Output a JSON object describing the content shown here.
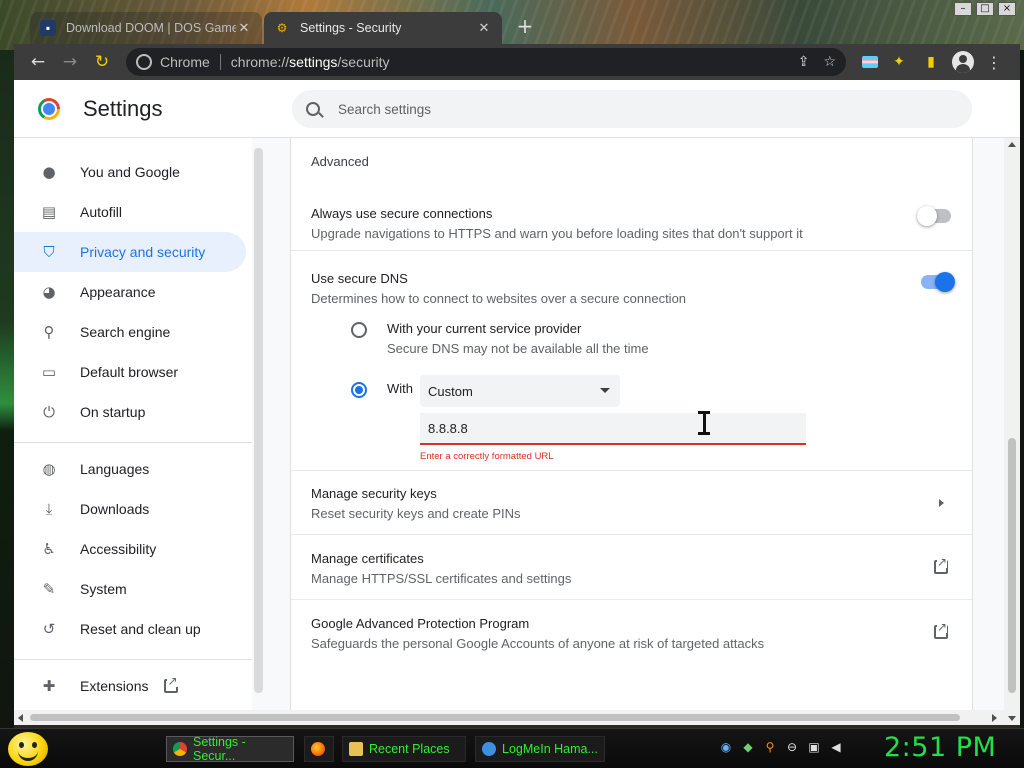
{
  "tabs": [
    {
      "title": "Download DOOM | DOS Games",
      "active": false
    },
    {
      "title": "Settings - Security",
      "active": true
    }
  ],
  "new_tab_label": "+",
  "omnibox": {
    "site_chip": "Chrome",
    "url_scheme": "chrome://",
    "url_host": "settings",
    "url_path": "/security"
  },
  "settings": {
    "title": "Settings",
    "search_placeholder": "Search settings",
    "sidebar": {
      "items": [
        {
          "label": "You and Google",
          "icon": "person-icon"
        },
        {
          "label": "Autofill",
          "icon": "clipboard-icon"
        },
        {
          "label": "Privacy and security",
          "icon": "shield-icon",
          "active": true
        },
        {
          "label": "Appearance",
          "icon": "palette-icon"
        },
        {
          "label": "Search engine",
          "icon": "search-icon"
        },
        {
          "label": "Default browser",
          "icon": "browser-icon"
        },
        {
          "label": "On startup",
          "icon": "power-icon"
        },
        {
          "label": "Languages",
          "icon": "globe-icon"
        },
        {
          "label": "Downloads",
          "icon": "download-icon"
        },
        {
          "label": "Accessibility",
          "icon": "accessibility-icon"
        },
        {
          "label": "System",
          "icon": "wrench-icon"
        },
        {
          "label": "Reset and clean up",
          "icon": "history-icon"
        },
        {
          "label": "Extensions",
          "icon": "puzzle-icon"
        }
      ]
    },
    "content": {
      "section_heading": "Advanced",
      "secure_connections": {
        "title": "Always use secure connections",
        "subtitle": "Upgrade navigations to HTTPS and warn you before loading sites that don't support it",
        "enabled": false
      },
      "secure_dns": {
        "title": "Use secure DNS",
        "subtitle": "Determines how to connect to websites over a secure connection",
        "enabled": true,
        "option_current": {
          "title": "With your current service provider",
          "subtitle": "Secure DNS may not be available all the time",
          "selected": false
        },
        "option_with": {
          "label": "With",
          "selected": true,
          "provider_value": "Custom",
          "custom_value": "8.8.8.8",
          "error": "Enter a correctly formatted URL"
        }
      },
      "security_keys": {
        "title": "Manage security keys",
        "subtitle": "Reset security keys and create PINs"
      },
      "certificates": {
        "title": "Manage certificates",
        "subtitle": "Manage HTTPS/SSL certificates and settings"
      },
      "advanced_protection": {
        "title": "Google Advanced Protection Program",
        "subtitle": "Safeguards the personal Google Accounts of anyone at risk of targeted attacks"
      }
    }
  },
  "taskbar": {
    "items": [
      {
        "label": "Settings - Secur...",
        "active": true,
        "icon": "chrome-icon"
      },
      {
        "label": "",
        "icon": "firefox-icon"
      },
      {
        "label": "Recent Places",
        "icon": "folder-icon"
      },
      {
        "label": "LogMeIn Hama...",
        "icon": "hamachi-icon"
      }
    ],
    "clock": "2:51 PM"
  },
  "colors": {
    "accent": "#1a73e8",
    "error": "#d93025",
    "clock": "#22e04a",
    "task_text": "#2ef02e"
  }
}
